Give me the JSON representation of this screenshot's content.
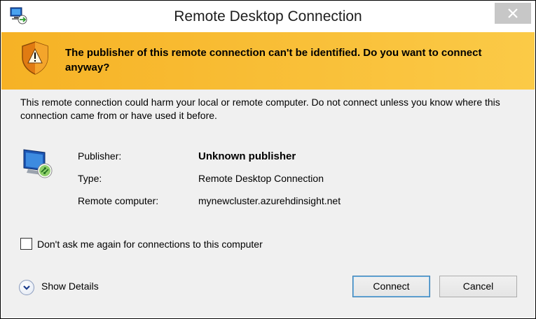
{
  "window": {
    "title": "Remote Desktop Connection",
    "close_icon": "close-icon"
  },
  "banner": {
    "icon": "warning-shield-icon",
    "text": "The publisher of this remote connection can't be identified. Do you want to connect anyway?",
    "color": "#f8bb2d"
  },
  "body": {
    "warning_text": "This remote connection could harm your local or remote computer. Do not connect unless you know where this connection came from or have used it before.",
    "icon": "remote-computer-icon",
    "info": [
      {
        "label": "Publisher:",
        "value": "Unknown publisher",
        "emphasis": true
      },
      {
        "label": "Type:",
        "value": "Remote Desktop Connection",
        "emphasis": false
      },
      {
        "label": "Remote computer:",
        "value": "mynewcluster.azurehdinsight.net",
        "emphasis": false
      }
    ],
    "checkbox": {
      "label": "Don't ask me again for connections to this computer",
      "checked": false
    }
  },
  "footer": {
    "show_details": "Show Details",
    "connect": "Connect",
    "cancel": "Cancel"
  }
}
